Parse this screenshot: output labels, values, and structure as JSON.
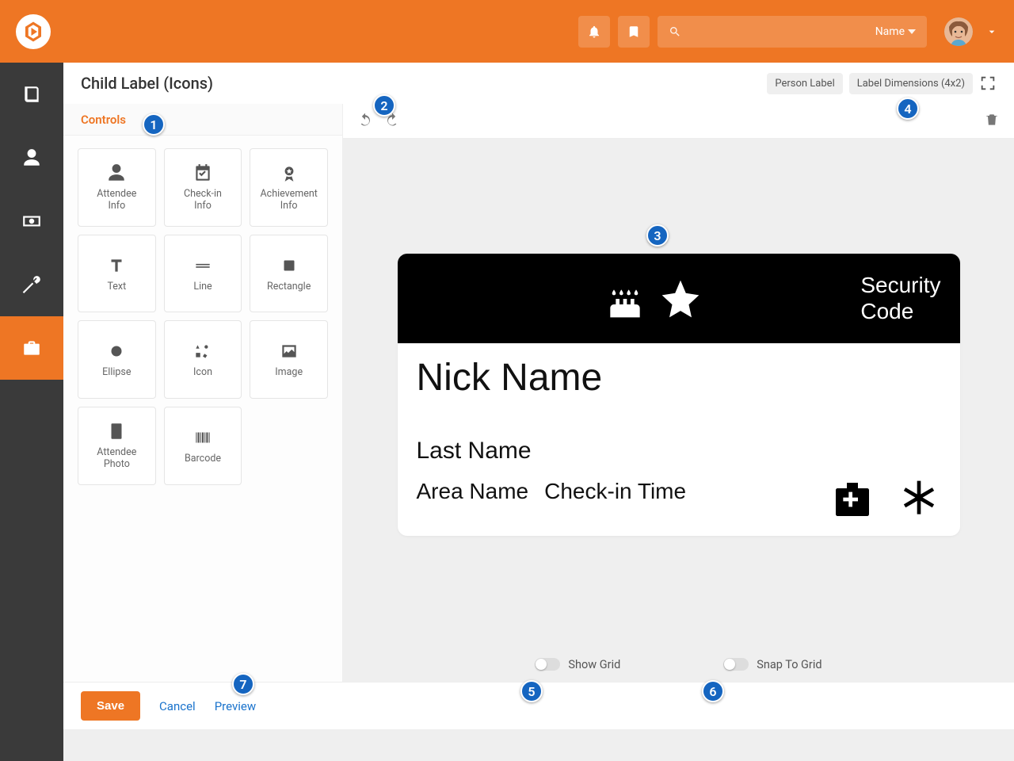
{
  "header": {
    "user_label": "Name",
    "search_placeholder": ""
  },
  "page": {
    "title": "Child Label (Icons)",
    "badge_person": "Person Label",
    "badge_dimensions": "Label Dimensions (4x2)"
  },
  "controls": {
    "header": "Controls",
    "items": [
      {
        "label": "Attendee\nInfo",
        "icon": "user"
      },
      {
        "label": "Check-in\nInfo",
        "icon": "calendar-check"
      },
      {
        "label": "Achievement\nInfo",
        "icon": "medal"
      },
      {
        "label": "Text",
        "icon": "text"
      },
      {
        "label": "Line",
        "icon": "line"
      },
      {
        "label": "Rectangle",
        "icon": "rect"
      },
      {
        "label": "Ellipse",
        "icon": "ellipse"
      },
      {
        "label": "Icon",
        "icon": "icons"
      },
      {
        "label": "Image",
        "icon": "image"
      },
      {
        "label": "Attendee\nPhoto",
        "icon": "badge"
      },
      {
        "label": "Barcode",
        "icon": "barcode"
      }
    ]
  },
  "label": {
    "security_code": "Security\nCode",
    "nick_name": "Nick Name",
    "last_name": "Last Name",
    "area_name": "Area Name",
    "checkin_time": "Check-in Time"
  },
  "toggles": {
    "show_grid": "Show Grid",
    "snap_to_grid": "Snap To Grid"
  },
  "footer": {
    "save": "Save",
    "cancel": "Cancel",
    "preview": "Preview"
  },
  "markers": [
    "1",
    "2",
    "3",
    "4",
    "5",
    "6",
    "7"
  ]
}
